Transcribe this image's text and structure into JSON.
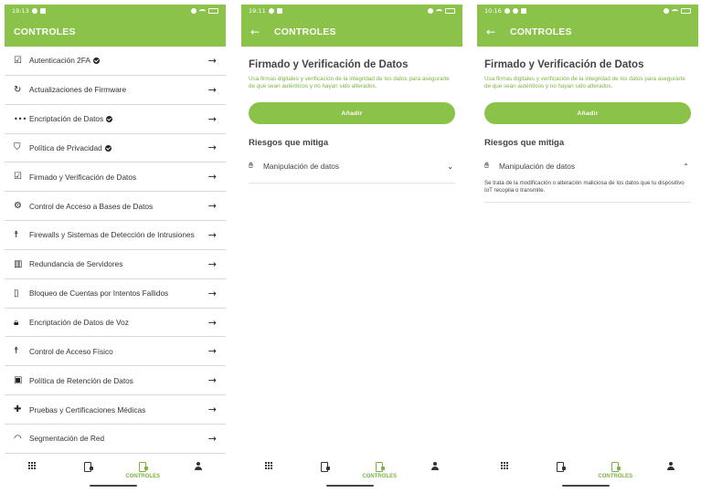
{
  "colors": {
    "accent": "#8bc34a",
    "accent_text": "#7cb342",
    "text_dark": "#333333"
  },
  "screens": [
    {
      "status": {
        "time": "19:13"
      },
      "appbar": {
        "title": "CONTROLES"
      },
      "list": [
        {
          "label": "Autenticación 2FA",
          "icon": "checkbox-icon",
          "verified": true
        },
        {
          "label": "Actualizaciones de Firmware",
          "icon": "update-icon",
          "verified": false
        },
        {
          "label": "Encriptación de Datos",
          "icon": "password-dots-icon",
          "verified": true
        },
        {
          "label": "Política de Privacidad",
          "icon": "shield-person-icon",
          "verified": true
        },
        {
          "label": "Firmado y Verificación de Datos",
          "icon": "clipboard-check-icon",
          "verified": false
        },
        {
          "label": "Control de Acceso a Bases de Datos",
          "icon": "user-gear-icon",
          "verified": false
        },
        {
          "label": "Firewalls y Sistemas de Detección de Intrusiones",
          "icon": "walking-person-icon",
          "verified": false
        },
        {
          "label": "Redundancia de Servidores",
          "icon": "server-icon",
          "verified": false
        },
        {
          "label": "Bloqueo de Cuentas por Intentos Fallidos",
          "icon": "phone-lock-icon",
          "verified": false
        },
        {
          "label": "Encriptación de Datos de Voz",
          "icon": "lock-icon",
          "verified": false
        },
        {
          "label": "Control de Acceso Físico",
          "icon": "running-person-icon",
          "verified": false
        },
        {
          "label": "Política de Retención de Datos",
          "icon": "save-icon",
          "verified": false
        },
        {
          "label": "Pruebas y Certificaciones Médicas",
          "icon": "bandage-icon",
          "verified": false
        },
        {
          "label": "Segmentación de Red",
          "icon": "wifi-icon",
          "verified": false
        }
      ]
    },
    {
      "status": {
        "time": "19:11"
      },
      "appbar": {
        "title": "CONTROLES"
      },
      "detail": {
        "title": "Firmado y Verificación de Datos",
        "description": "Usa firmas digitales y verificación de la integridad de los datos para asegurarte de que sean auténticos y no hayan sido alterados.",
        "add_button": "Añadir",
        "risks_title": "Riesgos que mitiga",
        "risk": {
          "label": "Manipulación de datos",
          "expanded": false
        }
      }
    },
    {
      "status": {
        "time": "10:16"
      },
      "appbar": {
        "title": "CONTROLES"
      },
      "detail": {
        "title": "Firmado y Verificación de Datos",
        "description": "Usa firmas digitales y verificación de la integridad de los datos para asegurarte de que sean auténticos y no hayan sido alterados.",
        "add_button": "Añadir",
        "risks_title": "Riesgos que mitiga",
        "risk": {
          "label": "Manipulación de datos",
          "expanded": true,
          "text": "Se trata de la modificación o alteración maliciosa de los datos que tu dispositivo IoT recopila o transmite."
        }
      }
    }
  ],
  "bottom_nav": {
    "items": [
      {
        "icon": "grid-icon",
        "label": ""
      },
      {
        "icon": "phone-settings-icon",
        "label": ""
      },
      {
        "icon": "controls-icon",
        "label": "CONTROLES",
        "active": true
      },
      {
        "icon": "person-icon",
        "label": ""
      }
    ]
  }
}
